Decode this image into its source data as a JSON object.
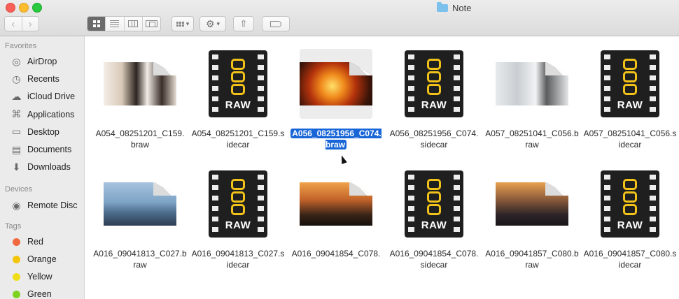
{
  "window": {
    "title": "Note"
  },
  "toolbar": {
    "back": "‹",
    "forward": "›",
    "gear": "⚙",
    "chevron": "▾",
    "share": "⇧"
  },
  "sidebar": {
    "favorites_header": "Favorites",
    "favorites": [
      {
        "label": "AirDrop",
        "icon": "airdrop-icon",
        "glyph": "◎"
      },
      {
        "label": "Recents",
        "icon": "recents-icon",
        "glyph": "◷"
      },
      {
        "label": "iCloud Drive",
        "icon": "cloud-icon",
        "glyph": "☁"
      },
      {
        "label": "Applications",
        "icon": "applications-icon",
        "glyph": "⌘"
      },
      {
        "label": "Desktop",
        "icon": "desktop-icon",
        "glyph": "▭"
      },
      {
        "label": "Documents",
        "icon": "documents-icon",
        "glyph": "▤"
      },
      {
        "label": "Downloads",
        "icon": "downloads-icon",
        "glyph": "⬇"
      }
    ],
    "devices_header": "Devices",
    "devices": [
      {
        "label": "Remote Disc",
        "icon": "disc-icon",
        "glyph": "◉"
      }
    ],
    "tags_header": "Tags",
    "tags": [
      {
        "label": "Red",
        "color": "#f06a3e"
      },
      {
        "label": "Orange",
        "color": "#f2c40a"
      },
      {
        "label": "Yellow",
        "color": "#f0dd1a"
      },
      {
        "label": "Green",
        "color": "#7ed321"
      }
    ]
  },
  "files": [
    {
      "name": "A054_08251201_C159.\nbraw",
      "kind": "photo",
      "bg": "linear-gradient(90deg,#f3ede6 0%,#d9c9b8 25%,#2c2420 45%,#f2ece6 60%,#3a2e28 80%,#e6ddd3 100%)"
    },
    {
      "name": "A054_08251201_C159.s\nidecar",
      "kind": "raw",
      "raw_text": "RAW"
    },
    {
      "name": "A056_08251956_C074.\nbraw",
      "kind": "photo",
      "selected": true,
      "bg": "radial-gradient(circle at 45% 55%,#ffe06a 0%,#f08a1c 25%,#b3320c 50%,#3b1408 80%,#1e0a05 100%)"
    },
    {
      "name": "A056_08251956_C074.\nsidecar",
      "kind": "raw",
      "raw_text": "RAW"
    },
    {
      "name": "A057_08251041_C056.b\nraw",
      "kind": "photo",
      "bg": "linear-gradient(90deg,#e7eaec 0%,#c9ced2 30%,#f1f2f3 55%,#5b5c5e 70%,#e4e6e8 100%)"
    },
    {
      "name": "A057_08251041_C056.s\nidecar",
      "kind": "raw",
      "raw_text": "RAW"
    },
    {
      "name": "A016_09041813_C027.b\nraw",
      "kind": "photo",
      "bg": "linear-gradient(180deg,#a5c3de 0%,#7fa4c6 45%,#4c6c8c 70%,#2e3e52 100%)"
    },
    {
      "name": "A016_09041813_C027.s\nidecar",
      "kind": "raw",
      "raw_text": "RAW"
    },
    {
      "name": "A016_09041854_C078.\n",
      "kind": "photo",
      "bg": "linear-gradient(180deg,#f0a24a 0%,#c2632a 40%,#3a2418 75%,#15100c 100%)"
    },
    {
      "name": "A016_09041854_C078.\nsidecar",
      "kind": "raw",
      "raw_text": "RAW"
    },
    {
      "name": "A016_09041857_C080.b\nraw",
      "kind": "photo",
      "bg": "linear-gradient(180deg,#e9a050 0%,#8a5a3a 40%,#2c2428 75%,#1a1618 100%)"
    },
    {
      "name": "A016_09041857_C080.s\nidecar",
      "kind": "raw",
      "raw_text": "RAW"
    }
  ]
}
